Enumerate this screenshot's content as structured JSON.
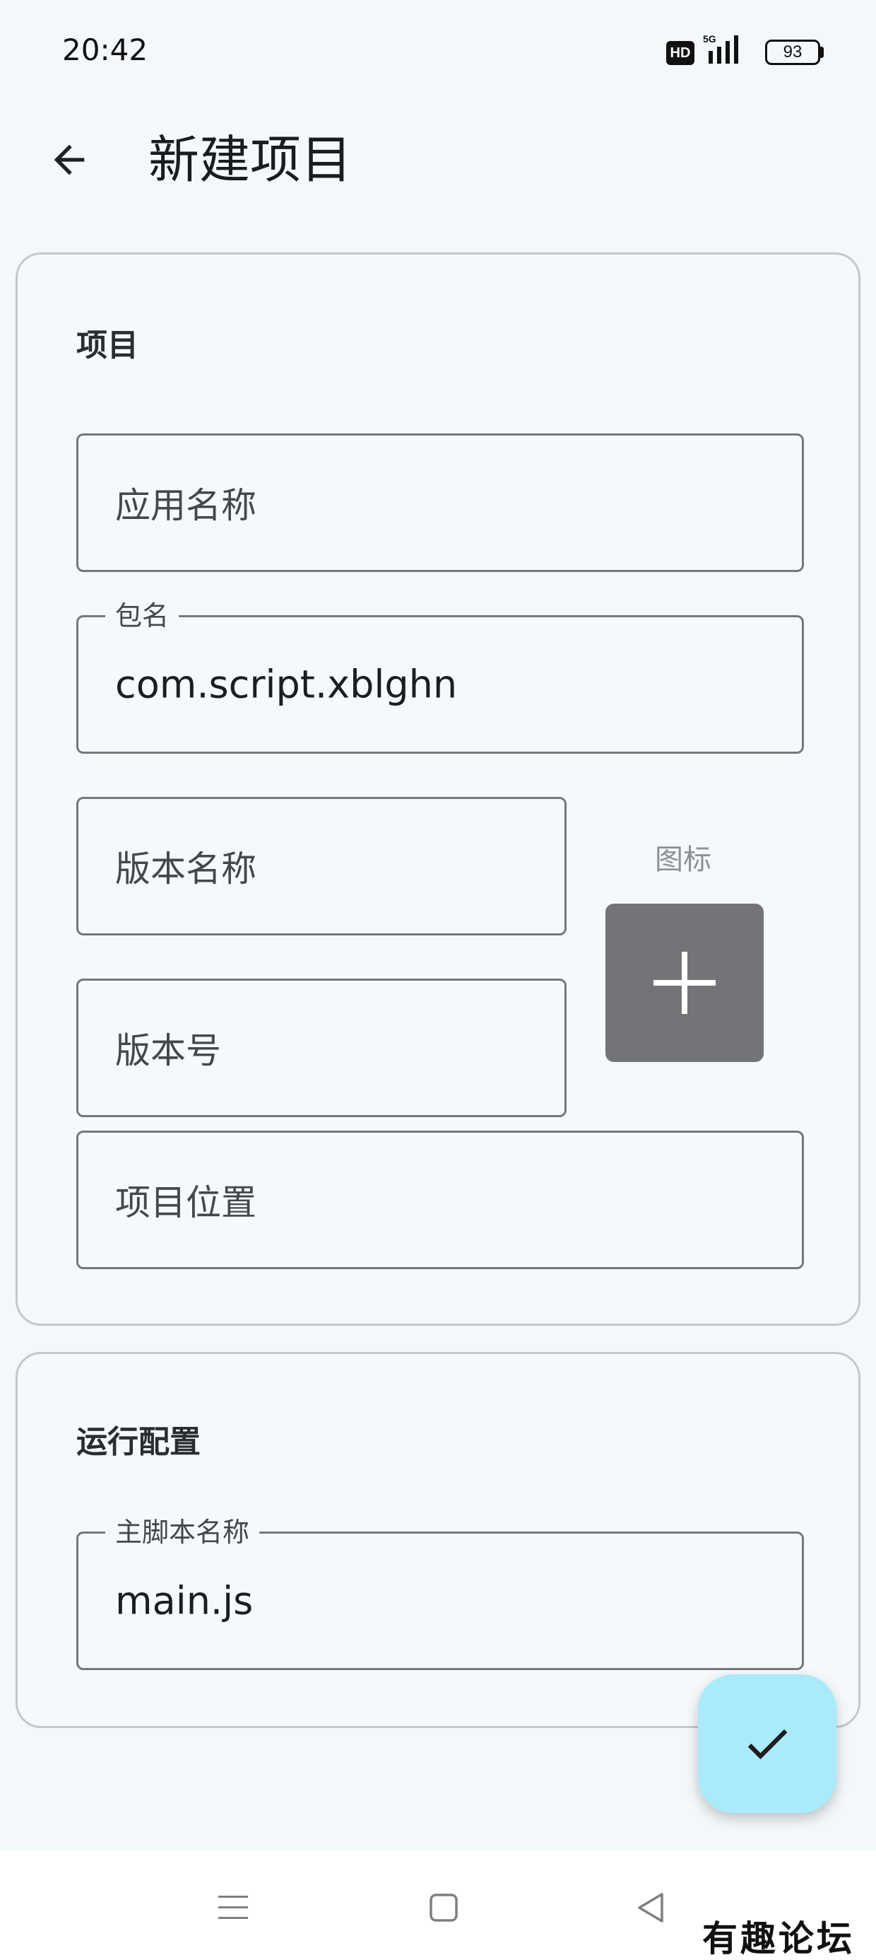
{
  "status_bar": {
    "time": "20:42",
    "hd_badge": "HD",
    "network": "5G",
    "battery": "93"
  },
  "app_bar": {
    "back_icon": "arrow-back-icon",
    "title": "新建项目"
  },
  "project_section": {
    "title": "项目",
    "app_name_label": "应用名称",
    "package_label": "包名",
    "package_value": "com.script.xblghn",
    "version_name_label": "版本名称",
    "version_code_label": "版本号",
    "icon_label": "图标",
    "icon_picker_icon": "plus-icon",
    "location_label": "项目位置"
  },
  "run_section": {
    "title": "运行配置",
    "main_script_label": "主脚本名称",
    "main_script_value": "main.js"
  },
  "fab": {
    "icon": "check-icon"
  },
  "nav_bar": {
    "menu_icon": "menu-icon",
    "home_icon": "square-home-icon",
    "back_icon": "triangle-back-icon"
  },
  "watermark": "有趣论坛",
  "colors": {
    "background": "#f3f8fb",
    "card_border": "#c4c8cd",
    "field_border": "#74777c",
    "icon_picker": "#737478",
    "fab": "#aaebfb"
  }
}
